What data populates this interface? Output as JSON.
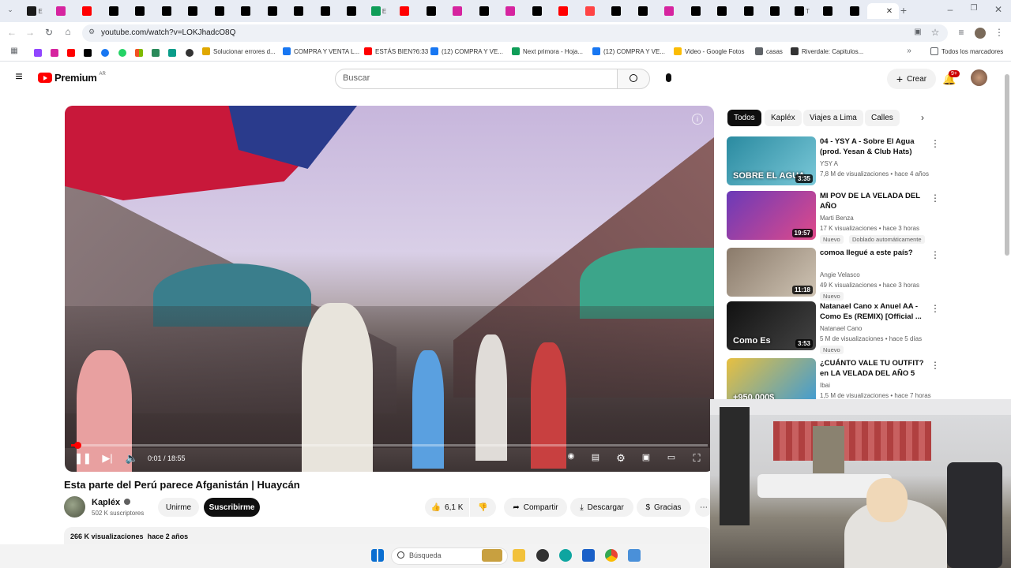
{
  "browser": {
    "url": "youtube.com/watch?v=LOKJhadcO8Q",
    "tab_letters": [
      "E",
      "",
      "",
      "",
      "",
      "",
      "",
      "",
      "",
      "",
      "",
      "",
      "",
      "E",
      "",
      "",
      "",
      "",
      "",
      "",
      "",
      "",
      "",
      "",
      "",
      "",
      "",
      "",
      "",
      "T",
      "",
      "",
      ""
    ],
    "bookmarks": [
      {
        "label": "Solucionar errores d...",
        "color": "#e0a800"
      },
      {
        "label": "COMPRA Y VENTA L...",
        "color": "#1877f2"
      },
      {
        "label": "ESTÁS BIEN?6:33",
        "color": "#ff0000"
      },
      {
        "label": "(12) COMPRA Y VE...",
        "color": "#1877f2"
      },
      {
        "label": "Next primora - Hoja...",
        "color": "#0f9d58"
      },
      {
        "label": "(12) COMPRA Y VE...",
        "color": "#1877f2"
      },
      {
        "label": "Video - Google Fotos",
        "color": "#fbbc04"
      },
      {
        "label": "casas",
        "color": "#5f6368"
      },
      {
        "label": "Riverdale: Capitulos...",
        "color": "#333333"
      }
    ],
    "all_bookmarks": "Todos los marcadores"
  },
  "yt": {
    "logo_text": "Premium",
    "logo_region": "AR",
    "search_placeholder": "Buscar",
    "create_label": "Crear",
    "notif_count": "9+"
  },
  "video": {
    "title": "Esta parte del Perú parece Afganistán | Huaycán",
    "time": "0:01 / 18:55",
    "progress_fraction": 0.001,
    "info": "i"
  },
  "channel": {
    "name": "Kapléx",
    "subscribers": "502 K suscriptores",
    "join_label": "Unirme",
    "subscribe_label": "Suscribirme"
  },
  "actions": {
    "likes": "6,1 K",
    "share": "Compartir",
    "download": "Descargar",
    "thanks": "Gracias"
  },
  "description": {
    "views": "266 K visualizaciones",
    "age": "hace 2 años"
  },
  "chips": [
    "Todos",
    "Kapléx",
    "Viajes a Lima",
    "Calles"
  ],
  "recommendations": [
    {
      "title": "04 - YSY A - Sobre El Agua (prod. Yesan & Club Hats)",
      "channel": "YSY A",
      "meta": "7,8 M de visualizaciones • hace 4 años",
      "duration": "3:35",
      "thumb_text": "SOBRE EL AGUA",
      "badges": []
    },
    {
      "title": "MI POV DE LA VELADA DEL AÑO",
      "channel": "Marti Benza",
      "meta": "17 K visualizaciones • hace 3 horas",
      "duration": "19:57",
      "thumb_text": "",
      "badges": [
        "Nuevo",
        "Doblado automáticamente"
      ]
    },
    {
      "title": "comoa llegué a este país?",
      "channel": "Angie Velasco",
      "meta": "49 K visualizaciones • hace 3 horas",
      "duration": "11:18",
      "thumb_text": "",
      "badges": [
        "Nuevo"
      ]
    },
    {
      "title": "Natanael Cano x Anuel AA - Como Es (REMIX) [Official ...",
      "channel": "Natanael Cano",
      "meta": "5 M de visualizaciones • hace 5 días",
      "duration": "3:53",
      "thumb_text": "Como Es",
      "badges": [
        "Nuevo"
      ]
    },
    {
      "title": "¿CUÁNTO VALE TU OUTFIT? en LA VELADA DEL AÑO 5",
      "channel": "Ibai",
      "meta": "1,5 M de visualizaciones • hace 7 horas",
      "duration": "",
      "thumb_text": "+950.000$",
      "badges": []
    }
  ],
  "taskbar": {
    "search": "Búsqueda"
  }
}
